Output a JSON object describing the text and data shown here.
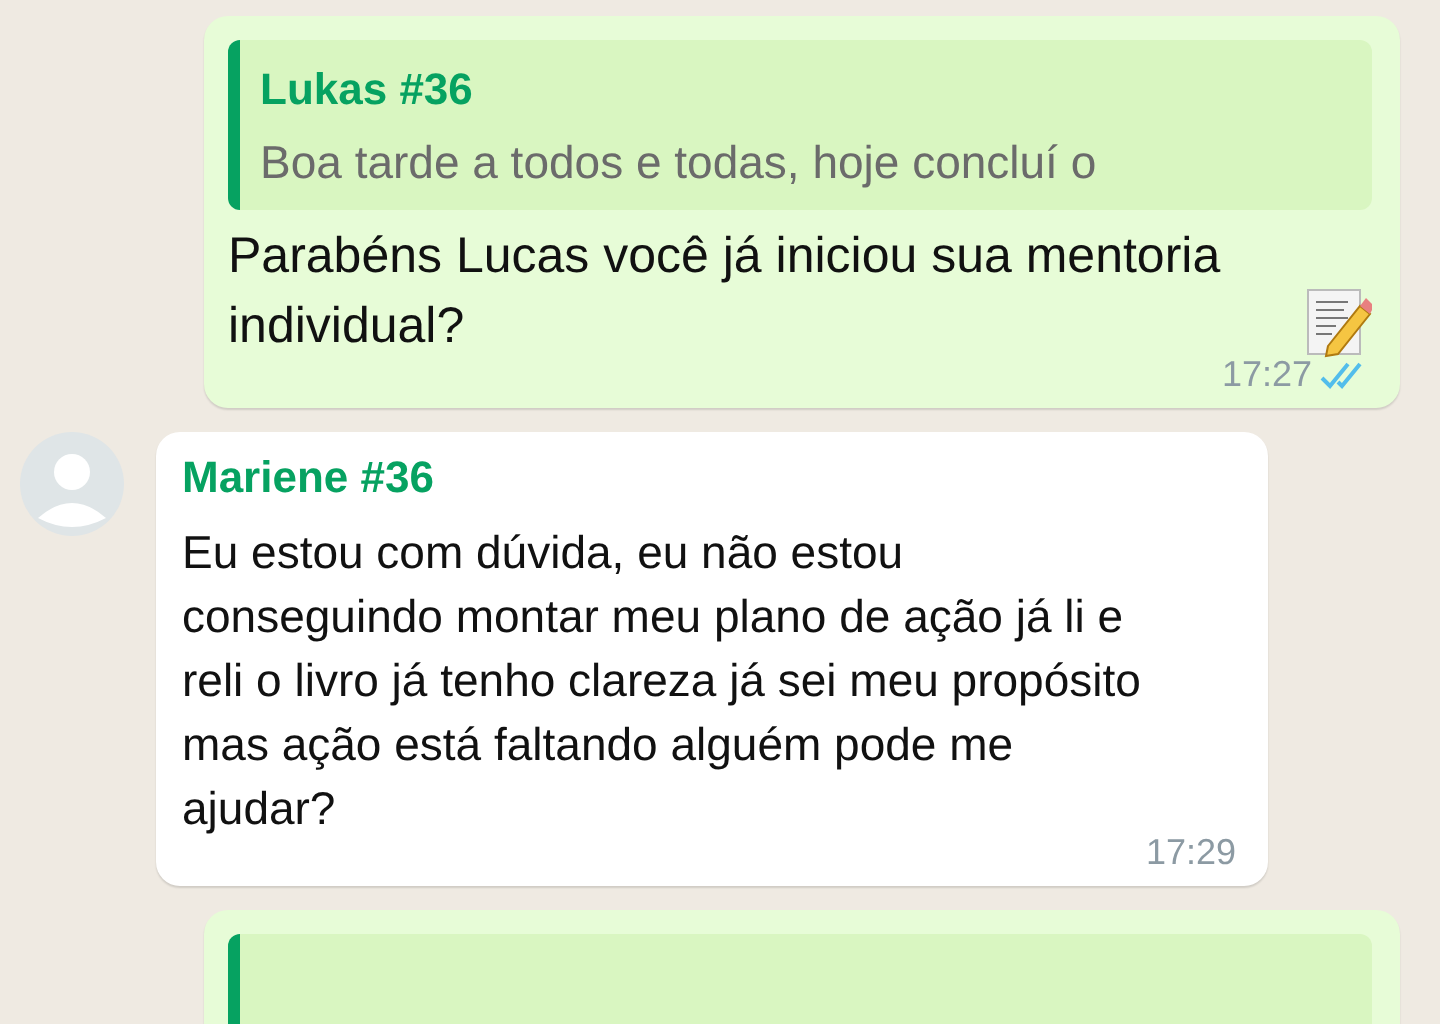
{
  "messages": [
    {
      "kind": "outgoing",
      "quote": {
        "author": "Lukas #36",
        "text": "Boa tarde a todos e todas, hoje concluí o"
      },
      "text": "Parabéns Lucas você já iniciou sua mentoria individual?",
      "emoji": true,
      "time": "17:27",
      "read": true
    },
    {
      "kind": "incoming",
      "sender": "Mariene #36",
      "text": "Eu estou com dúvida, eu não estou conseguindo montar meu plano de ação já li e reli o livro já tenho clareza já sei meu propósito mas ação está faltando alguém pode me ajudar?",
      "time": "17:29"
    },
    {
      "kind": "outgoing",
      "quoted": true
    }
  ]
}
